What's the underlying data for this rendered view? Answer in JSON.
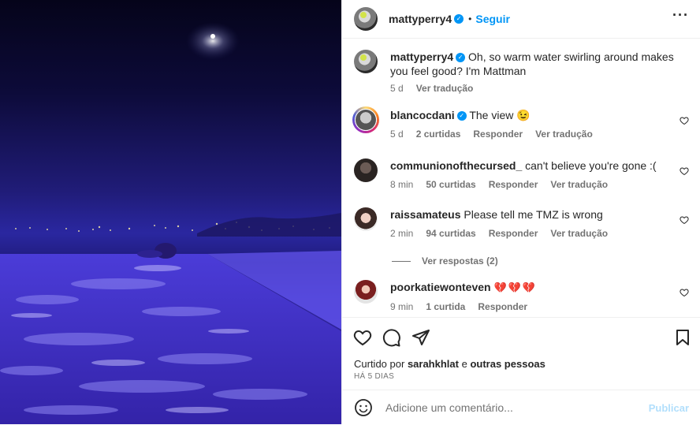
{
  "post": {
    "author": "mattyperry4",
    "follow_label": "Seguir",
    "separator": "•",
    "more_icon": "more-horizontal-icon",
    "caption": "Oh, so warm water swirling around makes you feel good? I'm Mattman",
    "caption_time": "5 d",
    "caption_translate": "Ver tradução"
  },
  "comments": [
    {
      "user": "blancocdani",
      "verified": true,
      "text": "The view",
      "emoji": "😉",
      "time": "5 d",
      "likes": "2 curtidas",
      "reply": "Responder",
      "translate": "Ver tradução"
    },
    {
      "user": "communionofthecursed_",
      "text": "can't believe you're gone :(",
      "time": "8 min",
      "likes": "50 curtidas",
      "reply": "Responder",
      "translate": "Ver tradução"
    },
    {
      "user": "raissamateus",
      "text": "Please tell me TMZ is wrong",
      "time": "2 min",
      "likes": "94 curtidas",
      "reply": "Responder",
      "translate": "Ver tradução"
    },
    {
      "user": "poorkatiewonteven",
      "text": "💔💔💔",
      "time": "9 min",
      "likes": "1 curtida",
      "reply": "Responder"
    }
  ],
  "view_replies": "Ver respostas (2)",
  "liked_by": {
    "prefix": "Curtido por",
    "user": "sarahkhlat",
    "conjunction": "e",
    "others": "outras pessoas"
  },
  "post_date": "HÁ 5 DIAS",
  "composer": {
    "placeholder": "Adicione um comentário...",
    "publish": "Publicar"
  },
  "colors": {
    "accent": "#0095f6",
    "publish_disabled": "#b2dffc",
    "muted": "#737373",
    "broken_heart": "#e0245e"
  }
}
